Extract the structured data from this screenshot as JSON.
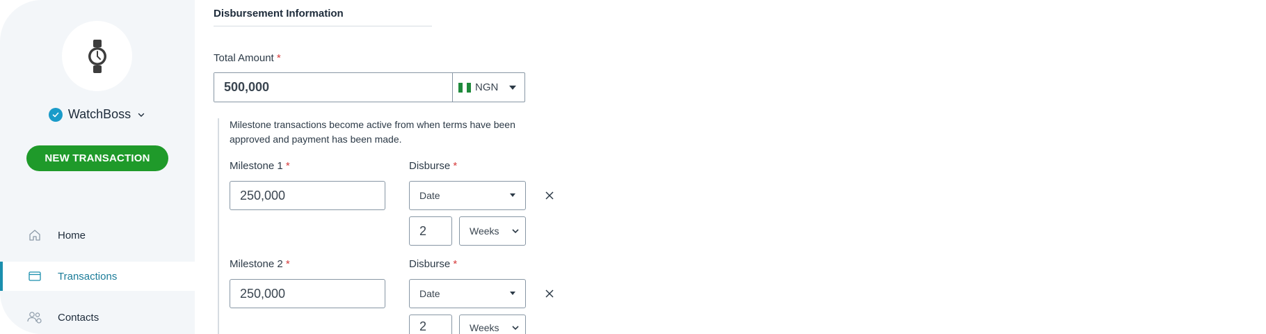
{
  "sidebar": {
    "account_name": "WatchBoss",
    "avatar_icon": "watch-icon",
    "new_transaction_label": "NEW TRANSACTION",
    "nav": [
      {
        "label": "Home",
        "icon": "home-icon"
      },
      {
        "label": "Transactions",
        "icon": "transactions-icon",
        "active": true
      },
      {
        "label": "Contacts",
        "icon": "contacts-icon"
      }
    ]
  },
  "main": {
    "section_title": "Disbursement Information",
    "total_amount": {
      "label": "Total Amount",
      "required_mark": "*",
      "value": "500,000",
      "currency": "NGN"
    },
    "note": "Milestone transactions become active from when terms have been approved and payment has been made.",
    "milestones": [
      {
        "label": "Milestone 1",
        "value": "250,000",
        "disburse_label": "Disburse",
        "disburse_type": "Date",
        "duration_value": "2",
        "duration_unit": "Weeks"
      },
      {
        "label": "Milestone 2",
        "value": "250,000",
        "disburse_label": "Disburse",
        "disburse_type": "Date",
        "duration_value": "2",
        "duration_unit": "Weeks"
      }
    ]
  },
  "colors": {
    "accent_green": "#1f9a2a",
    "accent_blue": "#1b8fae",
    "required_red": "#d63a3a"
  }
}
